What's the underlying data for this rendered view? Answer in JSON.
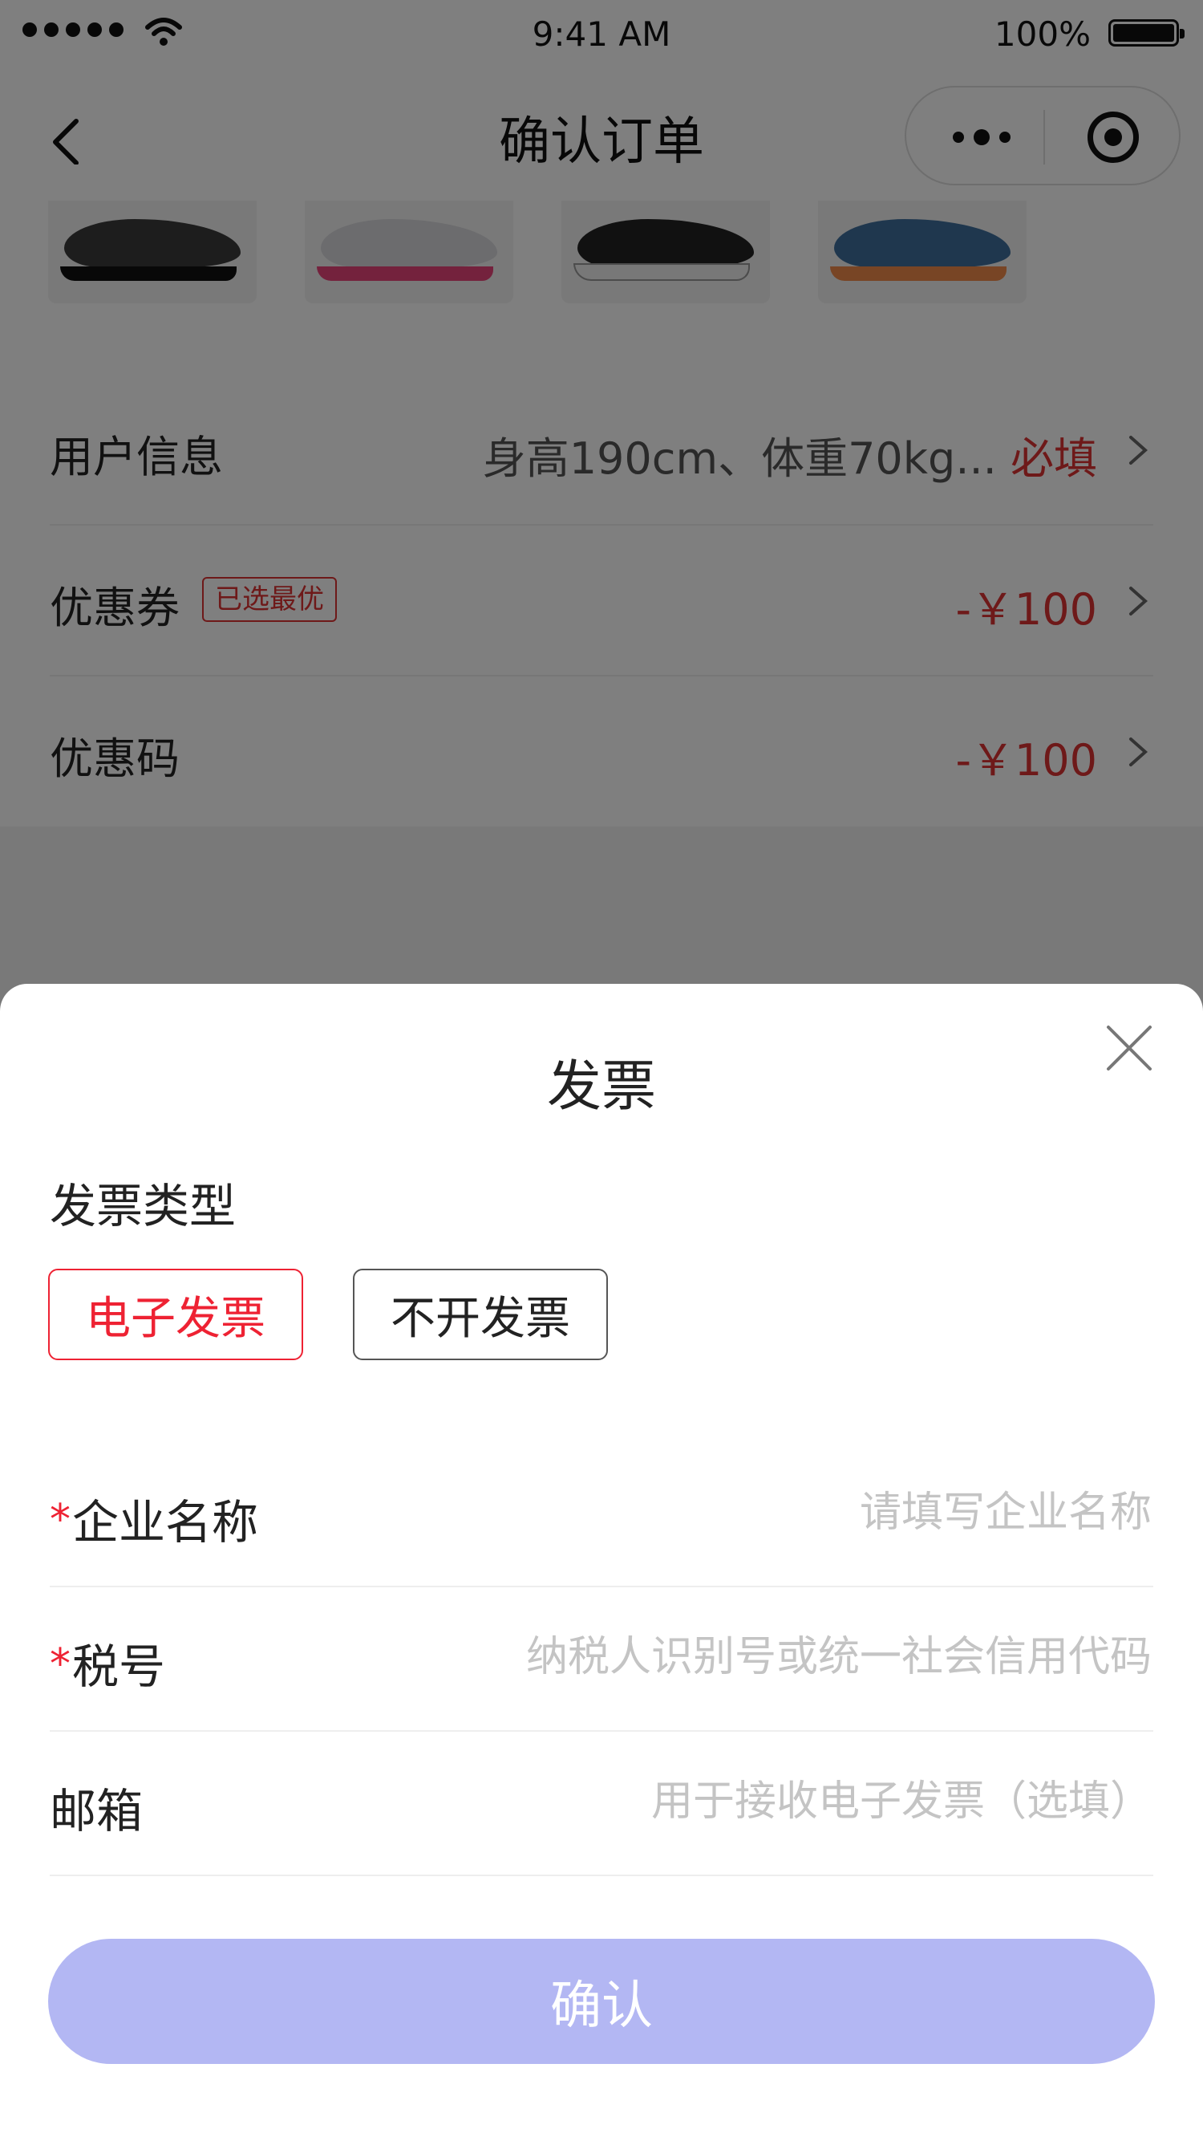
{
  "status_bar": {
    "time": "9:41 AM",
    "battery": "100%"
  },
  "nav": {
    "title": "确认订单"
  },
  "products": [
    {
      "icon": "shoe-black-icon"
    },
    {
      "icon": "shoe-white-pink-icon"
    },
    {
      "icon": "shoe-canvas-black-icon"
    },
    {
      "icon": "shoe-blue-icon"
    }
  ],
  "info": {
    "user": {
      "label": "用户信息",
      "value": "身高190cm、体重70kg...",
      "required": "必填"
    },
    "coupon": {
      "label": "优惠券",
      "tag": "已选最优",
      "value": "-￥100"
    },
    "promo": {
      "label": "优惠码",
      "value": "-￥100"
    }
  },
  "invoice": {
    "title": "发票",
    "type_label": "发票类型",
    "options": [
      "电子发票",
      "不开发票"
    ],
    "selected": "电子发票",
    "fields": {
      "company": {
        "label": "企业名称",
        "placeholder": "请填写企业名称",
        "required": true
      },
      "tax": {
        "label": "税号",
        "placeholder": "纳税人识别号或统一社会信用代码",
        "required": true
      },
      "email": {
        "label": "邮箱",
        "placeholder": "用于接收电子发票（选填）",
        "required": false
      }
    },
    "confirm": "确认"
  },
  "colors": {
    "accent_red": "#e23333",
    "confirm_button": "#b3b7f3",
    "overlay": "rgba(0,0,0,0.5)"
  }
}
